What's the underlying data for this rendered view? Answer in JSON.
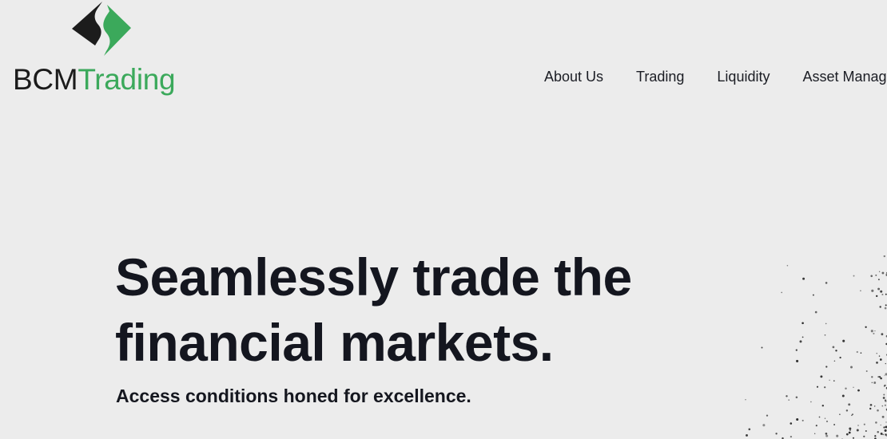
{
  "header": {
    "logo": {
      "part1": "BCM",
      "part2": "Trading",
      "brand_green": "#3ba95b",
      "brand_dark": "#1b1b1b"
    },
    "nav": [
      {
        "label": "About Us"
      },
      {
        "label": "Trading"
      },
      {
        "label": "Liquidity"
      },
      {
        "label": "Asset Manag"
      }
    ]
  },
  "hero": {
    "title_line1": "Seamlessly trade the",
    "title_line2": "financial markets.",
    "subtitle": "Access conditions honed for excellence."
  },
  "colors": {
    "background": "#ececec",
    "text": "#14161f"
  }
}
